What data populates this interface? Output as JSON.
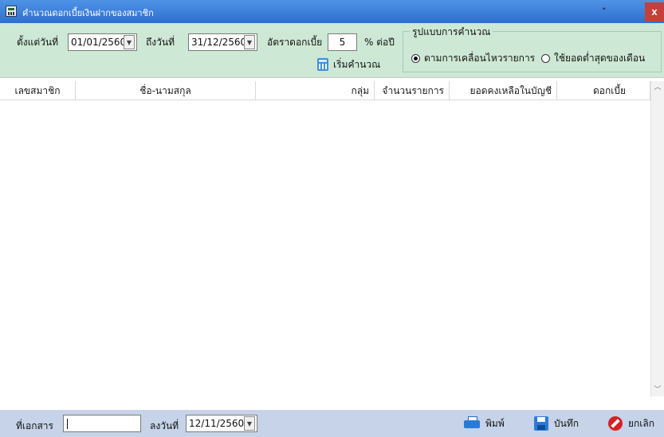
{
  "window": {
    "title": "คำนวณดอกเบี้ยเงินฝากของสมาชิก",
    "close_label": "x",
    "corner_glyph": "ู"
  },
  "filters": {
    "from_label": "ตั้งแต่วันที่",
    "from_date": "01/01/2560",
    "to_label": "ถึงวันที่",
    "to_date": "31/12/2560",
    "rate_label": "อัตราดอกเบี้ย",
    "rate_value": "5",
    "rate_unit": "% ต่อปี",
    "calc_button": "เริ่มคำนวณ",
    "method": {
      "legend": "รูปแบบการคำนวณ",
      "option_movement": "ตามการเคลื่อนไหวรายการ",
      "option_min_balance": "ใช้ยอดต่ำสุดของเดือน",
      "selected": "ตามการเคลื่อนไหวรายการ"
    }
  },
  "table": {
    "columns": [
      "เลขสมาชิก",
      "ชื่อ-นามสกุล",
      "กลุ่ม",
      "จำนวนรายการ",
      "ยอดคงเหลือในบัญชี",
      "ดอกเบี้ย"
    ],
    "rows": []
  },
  "footer": {
    "doc_label": "ที่เอกสาร",
    "doc_value": "",
    "date_label": "ลงวันที่",
    "date_value": "12/11/2560",
    "print_label": "พิมพ์",
    "save_label": "บันทึก",
    "cancel_label": "ยกเลิก"
  },
  "colors": {
    "titlebar": "#3a7fdc",
    "filter_bg": "#cde8d4",
    "footer_bg": "#c6d3e8",
    "cancel": "#d42323"
  },
  "icons": [
    "app-icon",
    "calculator-icon",
    "printer-icon",
    "floppy-icon",
    "cancel-icon",
    "scroll-up-icon",
    "scroll-down-icon"
  ]
}
